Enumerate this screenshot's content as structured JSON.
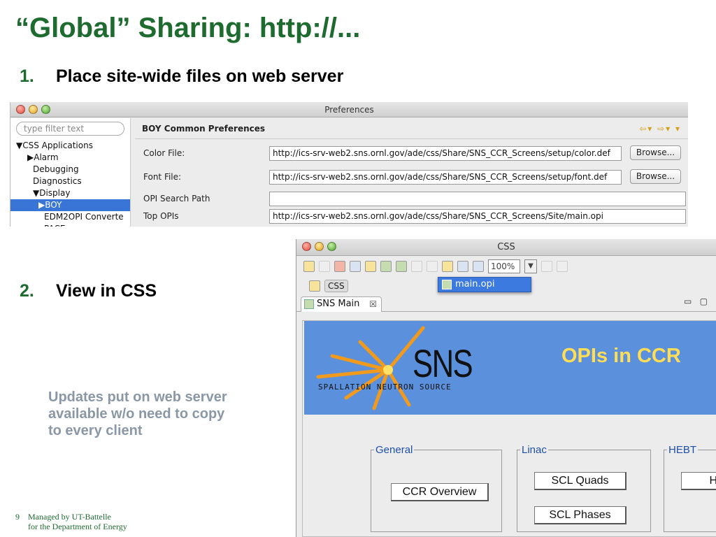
{
  "slide": {
    "title": "“Global” Sharing: http://...",
    "step1": {
      "num": "1.",
      "text": "Place site-wide files on web server"
    },
    "step2": {
      "num": "2.",
      "text": "View in CSS"
    },
    "note": "Updates put on web server available w/o need to copy to every client",
    "footer": {
      "page": "9",
      "line1": "Managed by UT-Battelle",
      "line2": "for the Department of Energy"
    }
  },
  "preferences": {
    "window_title": "Preferences",
    "filter_placeholder": "type filter text",
    "tree": [
      {
        "label": "▼CSS Applications",
        "indent": 8
      },
      {
        "label": "▶Alarm",
        "indent": 24
      },
      {
        "label": "Debugging",
        "indent": 32
      },
      {
        "label": "Diagnostics",
        "indent": 32
      },
      {
        "label": "▼Display",
        "indent": 32
      },
      {
        "label": "▶BOY",
        "indent": 40,
        "selected": true
      },
      {
        "label": "EDM2OPI Converte",
        "indent": 48
      },
      {
        "label": "PACE",
        "indent": 48
      }
    ],
    "page_title": "BOY Common Preferences",
    "nav": "⇦▾ ⇨▾ ▾",
    "rows": [
      {
        "label": "Color File:",
        "value": "http://ics-srv-web2.sns.ornl.gov/ade/css/Share/SNS_CCR_Screens/setup/color.def",
        "button": "Browse..."
      },
      {
        "label": "Font File:",
        "value": "http://ics-srv-web2.sns.ornl.gov/ade/css/Share/SNS_CCR_Screens/setup/font.def",
        "button": "Browse..."
      },
      {
        "label": "OPI Search Path",
        "value": ""
      },
      {
        "label": "Top OPIs",
        "value": "http://ics-srv-web2.sns.ornl.gov/ade/css/Share/SNS_CCR_Screens/Site/main.opi"
      }
    ]
  },
  "css_window": {
    "window_title": "CSS",
    "zoom": "100%",
    "dropdown_item": "main.opi",
    "perspective": "CSS",
    "tab_label": "SNS Main",
    "tab_close": "☒",
    "win_controls": "▭ ▢",
    "opi": {
      "logo_text": "SNS",
      "logo_sub": "SPALLATION NEUTRON SOURCE",
      "banner_title": "OPIs in CCR",
      "groups": [
        {
          "label": "General",
          "buttons": [
            "CCR Overview"
          ]
        },
        {
          "label": "Linac",
          "buttons": [
            "SCL Quads",
            "SCL Phases"
          ]
        },
        {
          "label": "HEBT",
          "buttons": [
            "H"
          ]
        }
      ]
    },
    "colors": {
      "banner": "#5b90dc",
      "banner_title": "#ffdd55",
      "group_label": "#1e4ea8"
    }
  },
  "colors": {
    "title_green": "#1e6b30",
    "note_gray": "#8a97a6",
    "selection": "#3875d7"
  }
}
